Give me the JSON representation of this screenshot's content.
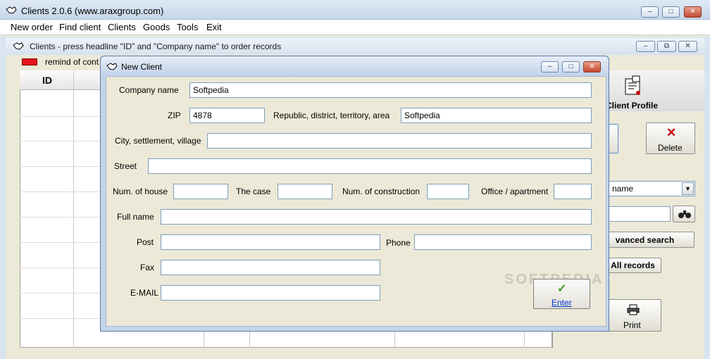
{
  "window": {
    "title": "Clients 2.0.6 (www.araxgroup.com)"
  },
  "menu": [
    "New order",
    "Find client",
    "Clients",
    "Goods",
    "Tools",
    "Exit"
  ],
  "child": {
    "title": "Clients - press headline \"ID\" and \"Company name\" to order records",
    "legend": "remind of cont"
  },
  "grid": {
    "headers": [
      "ID"
    ]
  },
  "side": {
    "profile": "Client Profile",
    "delete": "Delete",
    "name_select": "name",
    "advanced": "vanced search",
    "all": "All records",
    "print": "Print"
  },
  "dialog": {
    "title": "New Client",
    "labels": {
      "company": "Company name",
      "zip": "ZIP",
      "region": "Republic, district, territory, area",
      "city": "City, settlement, village",
      "street": "Street",
      "house": "Num. of house",
      "case": "The case",
      "construction": "Num. of construction",
      "office": "Office / apartment",
      "fullname": "Full name",
      "post": "Post",
      "phone": "Phone",
      "fax": "Fax",
      "email": "E-MAIL"
    },
    "values": {
      "company": "Softpedia",
      "zip": "4878",
      "region": "Softpedia",
      "city": "",
      "street": "",
      "house": "",
      "case": "",
      "construction": "",
      "office": "",
      "fullname": "",
      "post": "",
      "phone": "",
      "fax": "",
      "email": ""
    },
    "enter": "Enter"
  },
  "watermark": "SOFTPEDIA",
  "colors": {
    "remind": "#e8141c",
    "accent": "#0033cc"
  }
}
